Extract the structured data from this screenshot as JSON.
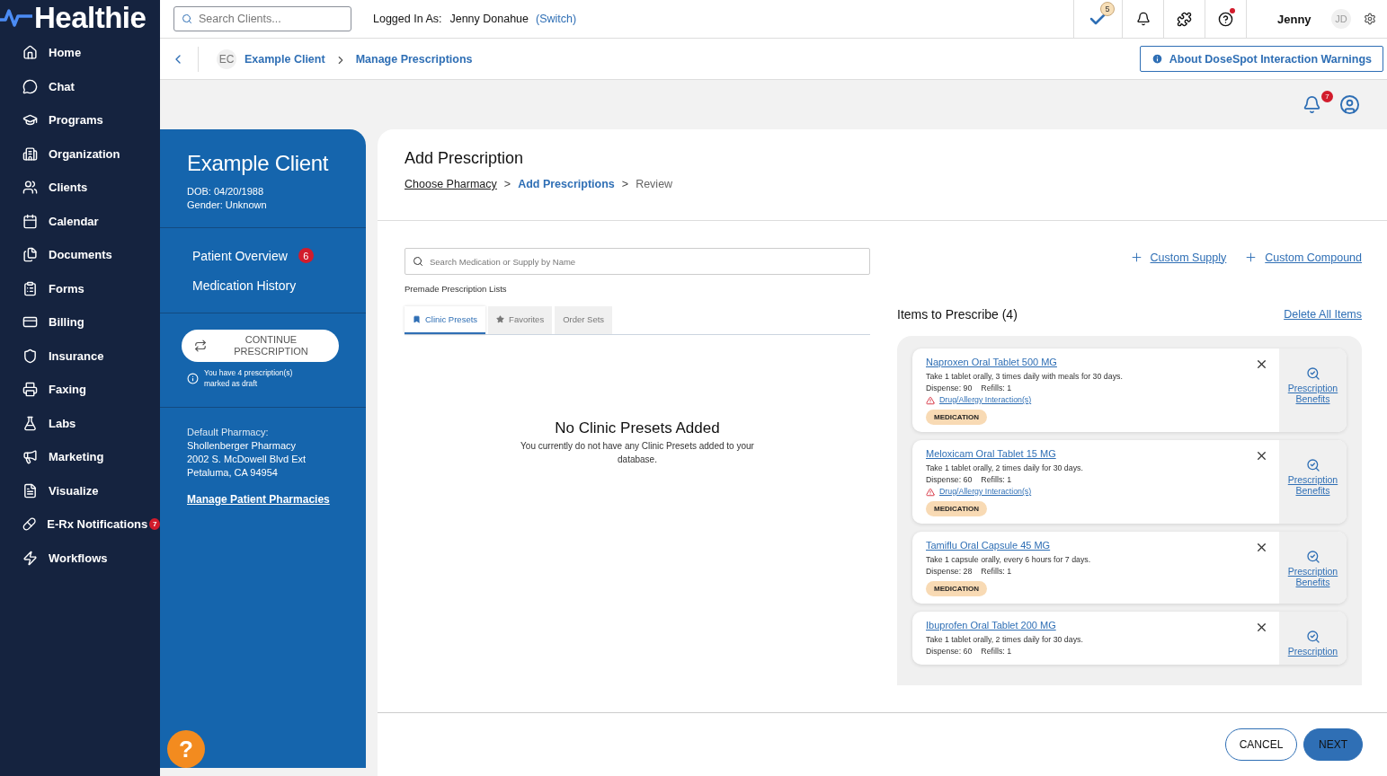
{
  "brand": {
    "name": "Healthie"
  },
  "sidebar": {
    "items": [
      {
        "label": "Home"
      },
      {
        "label": "Chat"
      },
      {
        "label": "Programs"
      },
      {
        "label": "Organization"
      },
      {
        "label": "Clients"
      },
      {
        "label": "Calendar"
      },
      {
        "label": "Documents"
      },
      {
        "label": "Forms"
      },
      {
        "label": "Billing"
      },
      {
        "label": "Insurance"
      },
      {
        "label": "Faxing"
      },
      {
        "label": "Labs"
      },
      {
        "label": "Marketing"
      },
      {
        "label": "Visualize"
      },
      {
        "label": "E-Rx Notifications",
        "badge": "7"
      },
      {
        "label": "Workflows"
      }
    ]
  },
  "topbar": {
    "search": {
      "placeholder": "Search Clients..."
    },
    "logged_in_label": "Logged In As:",
    "user_name": "Jenny Donahue",
    "switch_link": "(Switch)",
    "tasks_badge": "5",
    "help_has_alert": true,
    "display_name": "Jenny",
    "initials": "JD"
  },
  "breadcrumb": {
    "initials": "EC",
    "items": [
      "Example Client",
      "Manage Prescriptions"
    ],
    "info_button": "About DoseSpot Interaction Warnings"
  },
  "notifications": {
    "badge": "7"
  },
  "patient": {
    "name": "Example Client",
    "dob": "DOB: 04/20/1988",
    "gender": "Gender: Unknown",
    "nav": [
      {
        "label": "Patient Overview",
        "badge": "6"
      },
      {
        "label": "Medication History"
      }
    ],
    "continue_button": "CONTINUE PRESCRIPTION",
    "draft_note": "You have 4 prescription(s) marked as draft",
    "pharmacy_label": "Default Pharmacy:",
    "pharmacy_lines": [
      "Shollenberger Pharmacy",
      "2002 S. McDowell Blvd Ext",
      "Petaluma, CA 94954"
    ],
    "manage_link": "Manage Patient Pharmacies"
  },
  "prescription": {
    "title": "Add Prescription",
    "steps": [
      {
        "label": "Choose Pharmacy",
        "completed": true,
        "selected": false
      },
      {
        "label": "Add Prescriptions",
        "completed": false,
        "selected": true
      },
      {
        "label": "Review",
        "completed": false,
        "selected": false
      }
    ],
    "step_separator": ">",
    "search": {
      "placeholder": "Search Medication or Supply by Name"
    },
    "lists_label": "Premade Prescription Lists",
    "tabs": [
      {
        "label": "Clinic Presets",
        "selected": true
      },
      {
        "label": "Favorites",
        "selected": false
      },
      {
        "label": "Order Sets",
        "selected": false
      }
    ],
    "empty_title": "No Clinic Presets Added",
    "empty_text": "You currently do not have any Clinic Presets added to your database.",
    "add_links": [
      "Custom Supply",
      "Custom Compound"
    ],
    "items_heading": "Items to Prescribe (4)",
    "delete_all": "Delete All Items",
    "items": [
      {
        "name": "Naproxen Oral Tablet 500 MG",
        "sig": "Take 1 tablet orally, 3 times daily with meals for 30 days.",
        "dispense": "Dispense: 90",
        "refills": "Refills: 1",
        "interaction": "Drug/Allergy Interaction(s)",
        "tag": "MEDICATION",
        "benefits": "Prescription Benefits"
      },
      {
        "name": "Meloxicam Oral Tablet 15 MG",
        "sig": "Take 1 tablet orally, 2 times daily for 30 days.",
        "dispense": "Dispense: 60",
        "refills": "Refills: 1",
        "interaction": "Drug/Allergy Interaction(s)",
        "tag": "MEDICATION",
        "benefits": "Prescription Benefits"
      },
      {
        "name": "Tamiflu Oral Capsule 45 MG",
        "sig": "Take 1 capsule orally, every 6 hours for 7 days.",
        "dispense": "Dispense: 28",
        "refills": "Refills: 1",
        "tag": "MEDICATION",
        "benefits": "Prescription Benefits"
      },
      {
        "name": "Ibuprofen Oral Tablet 200 MG",
        "sig": "Take 1 tablet orally, 2 times daily for 30 days.",
        "dispense": "Dispense: 60",
        "refills": "Refills: 1",
        "benefits": "Prescription"
      }
    ],
    "cancel": "CANCEL",
    "next": "NEXT"
  },
  "help_button": "?"
}
